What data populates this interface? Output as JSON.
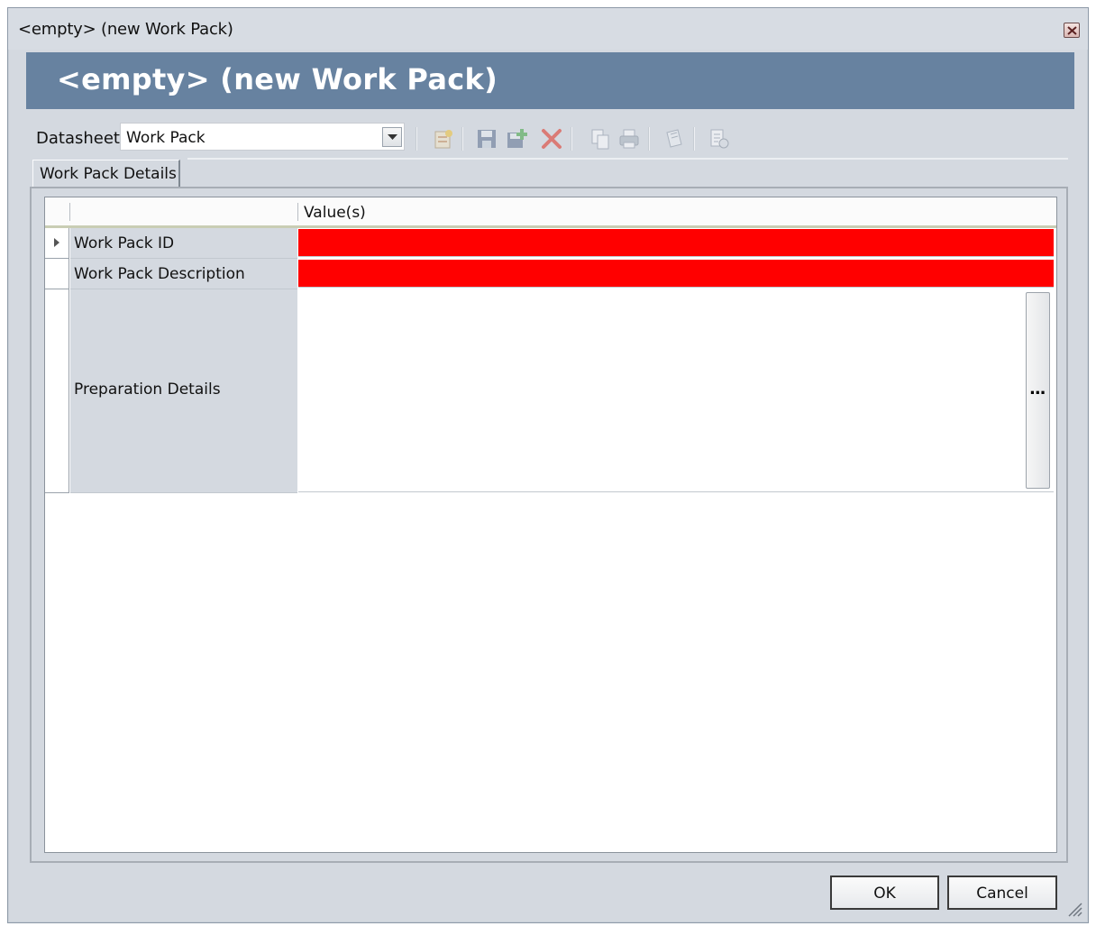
{
  "window": {
    "title": "<empty> (new Work Pack)",
    "banner_title": "<empty> (new Work Pack)"
  },
  "toolbar": {
    "datasheet_label": "Datasheet",
    "datasheet_value": "Work Pack",
    "icons": [
      "new-record-icon",
      "save-icon",
      "save-and-new-icon",
      "delete-icon",
      "copy-icon",
      "print-icon",
      "reference-icon",
      "datasheet-properties-icon"
    ]
  },
  "tabs": [
    {
      "label": "Work Pack Details",
      "active": true
    }
  ],
  "grid": {
    "header_value": "Value(s)",
    "rows": [
      {
        "label": "Work Pack ID",
        "value": "",
        "required": true,
        "current": true
      },
      {
        "label": "Work Pack Description",
        "value": "",
        "required": true,
        "current": false
      },
      {
        "label": "Preparation Details",
        "value": "",
        "required": false,
        "current": false,
        "memo_button": "..."
      }
    ]
  },
  "buttons": {
    "ok": "OK",
    "cancel": "Cancel"
  },
  "colors": {
    "banner": "#6782a0",
    "required_field": "#ff0000",
    "window_bg": "#d4d9e0"
  }
}
